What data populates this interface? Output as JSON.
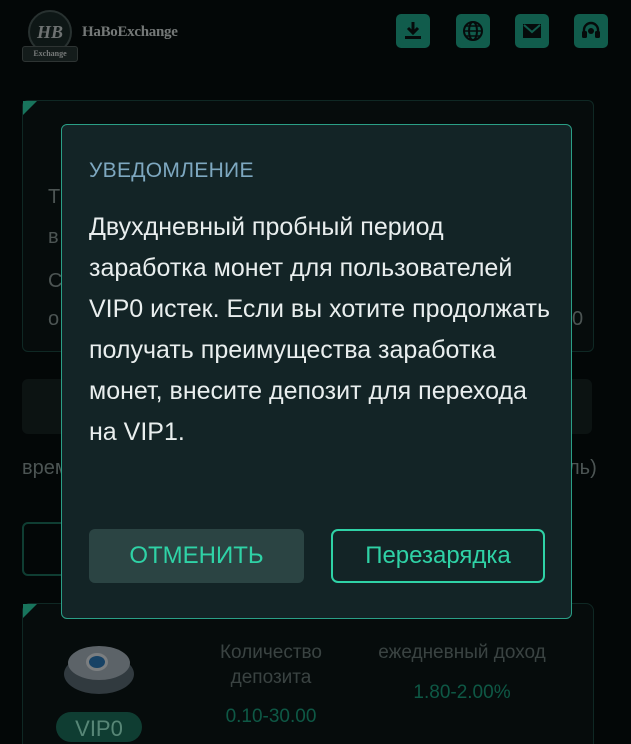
{
  "header": {
    "logo_mark": "HB",
    "logo_ribbon": "Exchange",
    "logo_text": "HaBoExchange",
    "icons": [
      "download-icon",
      "globe-icon",
      "mail-icon",
      "support-headset-icon"
    ]
  },
  "background": {
    "card_fragments": [
      "Т",
      "в",
      "С",
      "о",
      "0"
    ],
    "row_left": "врем",
    "row_right": "ль)",
    "plan": {
      "vip_label": "VIP0",
      "deposit_label": "Количество депозита",
      "deposit_value": "0.10-30.00",
      "income_label": "ежедневный доход",
      "income_value": "1.80-2.00%"
    }
  },
  "modal": {
    "title": "УВЕДОМЛЕНИЕ",
    "message": "Двухдневный пробный период заработка монет для пользователей VIP0 истек. Если вы хотите продолжать получать преимущества заработка монет, внесите депозит для перехода на VIP1.",
    "cancel_label": "ОТМЕНИТЬ",
    "recharge_label": "Перезарядка"
  },
  "colors": {
    "accent": "#2fd2a6",
    "modal_bg": "#132426",
    "title": "#7ea8c0"
  }
}
